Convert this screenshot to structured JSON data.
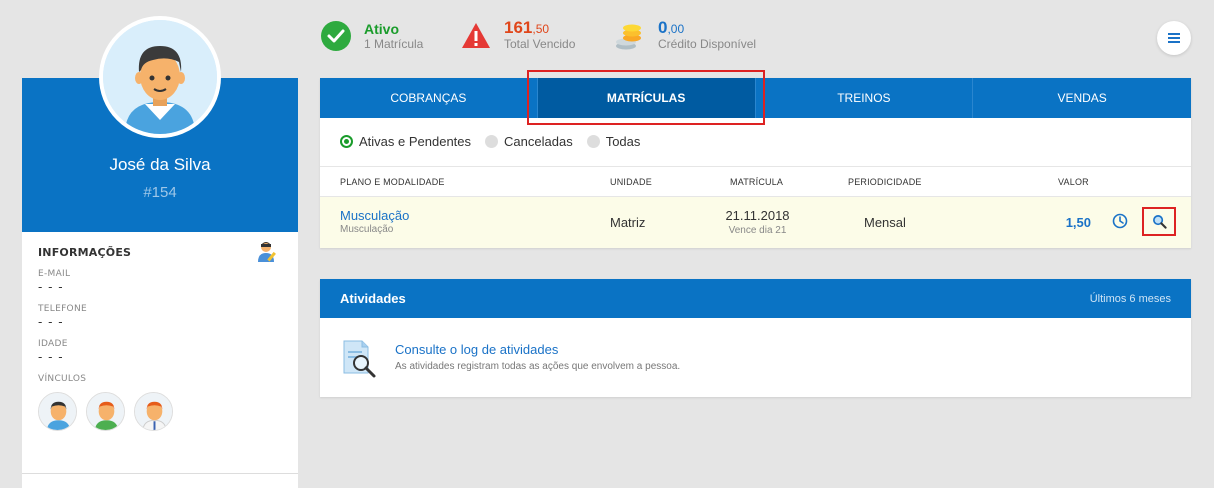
{
  "profile": {
    "name": "José da Silva",
    "id": "#154"
  },
  "info": {
    "title": "INFORMAÇÕES",
    "fields": [
      {
        "label": "E-MAIL",
        "value": "- - -"
      },
      {
        "label": "TELEFONE",
        "value": "- - -"
      },
      {
        "label": "IDADE",
        "value": "- - -"
      }
    ],
    "vinculos_label": "VÍNCULOS"
  },
  "status": {
    "ativo": {
      "main": "Ativo",
      "sub": "1 Matrícula",
      "color": "#1a9c2b"
    },
    "vencido": {
      "int": "161",
      "dec": ",50",
      "sub": "Total Vencido",
      "color": "#e0461a"
    },
    "credito": {
      "int": "0",
      "dec": ",00",
      "sub": "Crédito Disponível",
      "color": "#1a72c7"
    }
  },
  "tabs": [
    {
      "label": "COBRANÇAS",
      "active": false
    },
    {
      "label": "MATRÍCULAS",
      "active": true
    },
    {
      "label": "TREINOS",
      "active": false
    },
    {
      "label": "VENDAS",
      "active": false
    }
  ],
  "filters": [
    {
      "label": "Ativas e Pendentes",
      "selected": true
    },
    {
      "label": "Canceladas",
      "selected": false
    },
    {
      "label": "Todas",
      "selected": false
    }
  ],
  "table": {
    "headers": {
      "plano": "PLANO E MODALIDADE",
      "unidade": "UNIDADE",
      "matricula": "MATRÍCULA",
      "periodicidade": "PERIODICIDADE",
      "valor": "VALOR"
    },
    "row": {
      "plano": "Musculação",
      "modalidade": "Musculação",
      "unidade": "Matriz",
      "data": "21.11.2018",
      "vence": "Vence dia 21",
      "periodicidade": "Mensal",
      "valor": "1,50"
    }
  },
  "atividades": {
    "title": "Atividades",
    "range": "Últimos 6 meses",
    "link": "Consulte o log de atividades",
    "desc": "As atividades registram todas as ações que envolvem a pessoa."
  },
  "colors": {
    "primary": "#0a73c4",
    "highlight": "#dd2222"
  }
}
